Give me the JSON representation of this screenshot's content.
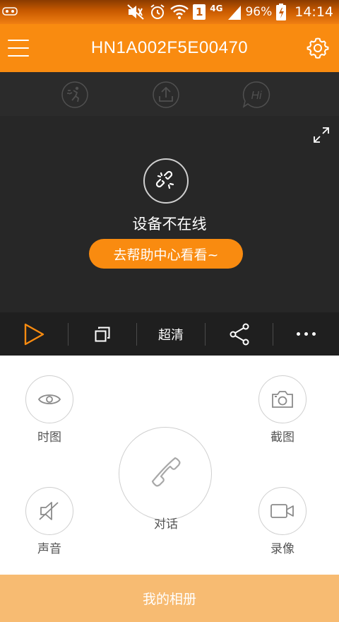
{
  "status_bar": {
    "sim_slot": "1",
    "network_type": "4G",
    "battery": "96%",
    "time": "14:14"
  },
  "app_bar": {
    "title": "HN1A002F5E00470",
    "menu_icon": "hamburger-menu-icon",
    "settings_icon": "gear-icon"
  },
  "feature_bar": {
    "icons": [
      "motion-detection-icon",
      "upload-icon",
      "hi-greeting-icon"
    ],
    "greeting_text": "Hi"
  },
  "video": {
    "offline_message": "设备不在线",
    "help_button": "去帮助中心看看~",
    "offline_icon": "broken-link-icon",
    "fullscreen_icon": "fullscreen-icon"
  },
  "control_bar": {
    "quality_label": "超清",
    "icons": [
      "play-icon",
      "copy-icon",
      "share-icon",
      "more-icon"
    ]
  },
  "actions": {
    "snapshot_view": "时图",
    "screenshot": "截图",
    "talk": "对话",
    "sound": "声音",
    "record": "录像"
  },
  "album_button": "我的相册",
  "colors": {
    "brand_orange": "#f98b10",
    "album_orange": "#f7bb72",
    "dark_bg": "#272727"
  }
}
